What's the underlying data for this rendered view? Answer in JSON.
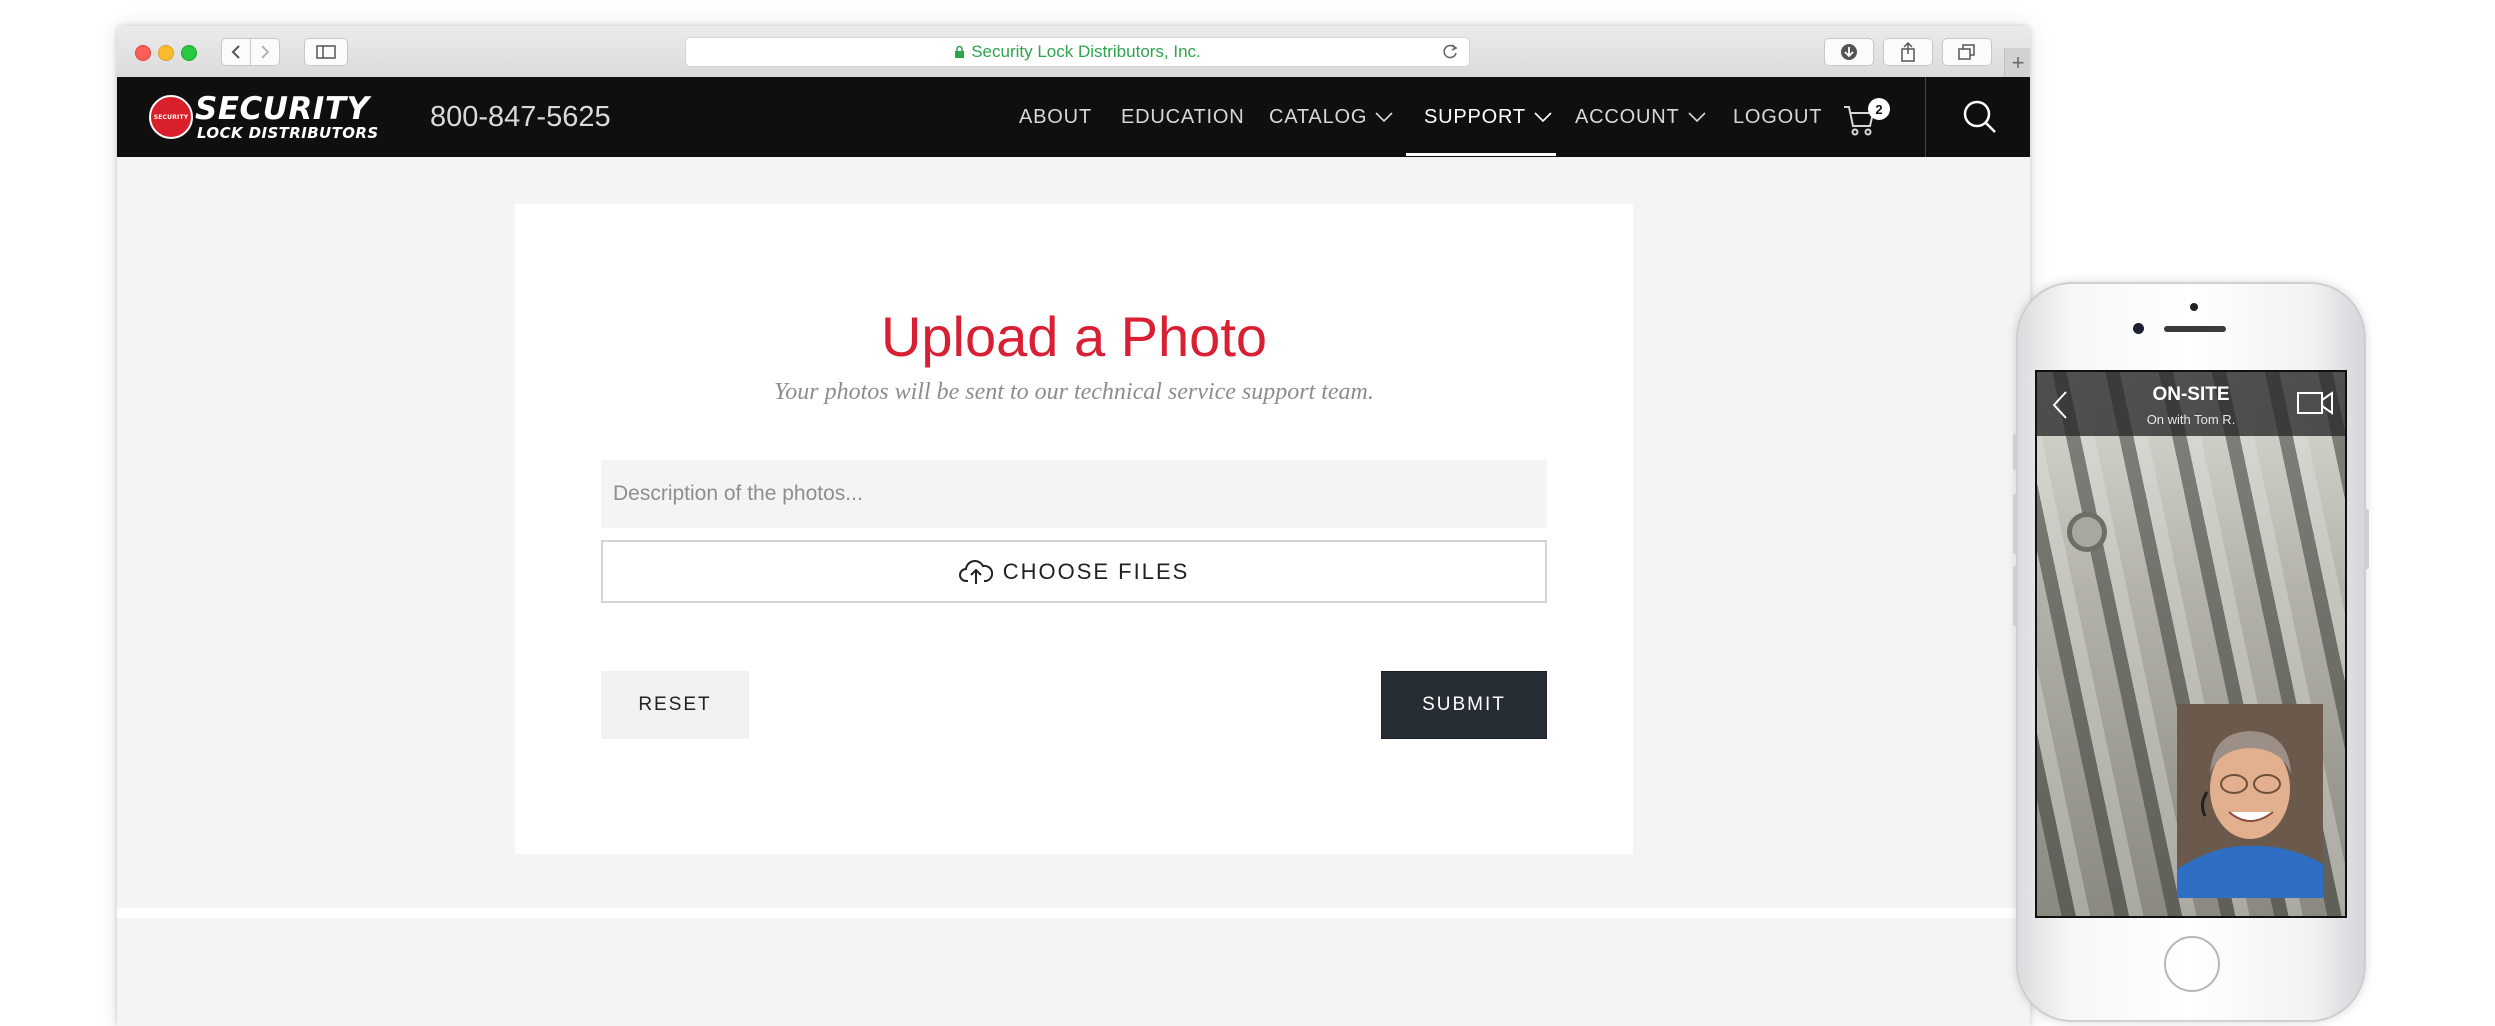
{
  "browser": {
    "url_title": "Security Lock Distributors, Inc.",
    "new_tab_glyph": "+"
  },
  "header": {
    "logo_line1": "SECURITY",
    "logo_line2": "LOCK DISTRIBUTORS",
    "logo_badge": "SECURITY",
    "phone": "800-847-5625",
    "nav": [
      {
        "label": "ABOUT",
        "has_dropdown": false,
        "active": false
      },
      {
        "label": "EDUCATION",
        "has_dropdown": false,
        "active": false
      },
      {
        "label": "CATALOG",
        "has_dropdown": true,
        "active": false
      },
      {
        "label": "SUPPORT",
        "has_dropdown": true,
        "active": true
      },
      {
        "label": "ACCOUNT",
        "has_dropdown": true,
        "active": false
      },
      {
        "label": "LOGOUT",
        "has_dropdown": false,
        "active": false
      }
    ],
    "cart_count": "2",
    "icons": {
      "cart": "cart-icon",
      "search": "search-icon"
    }
  },
  "upload": {
    "title": "Upload a Photo",
    "subtitle": "Your photos will be sent to our technical service support team.",
    "description_placeholder": "Description of the photos...",
    "description_value": "",
    "choose_files_label": "CHOOSE FILES",
    "reset_label": "RESET",
    "submit_label": "SUBMIT"
  },
  "phone_app": {
    "call_title": "ON-SITE",
    "call_subtitle": "On with Tom R."
  },
  "colors": {
    "accent_red": "#d81f33",
    "header_bg": "#0f0f0f",
    "submit_bg": "#262d35",
    "url_green": "#2ea44f"
  }
}
